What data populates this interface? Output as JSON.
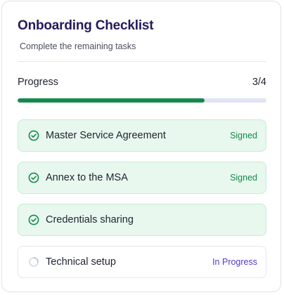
{
  "header": {
    "title": "Onboarding Checklist",
    "subtitle": "Complete the remaining tasks"
  },
  "progress": {
    "label": "Progress",
    "count_text": "3/4",
    "completed": 3,
    "total": 4,
    "fraction": 0.75
  },
  "colors": {
    "title": "#231a5c",
    "progress_fill": "#16894f",
    "progress_track": "#dfe4f5",
    "done_bg": "#e8f8ee",
    "done_border": "#c5ecd2",
    "signed": "#138a4d",
    "in_progress": "#4f3cc9"
  },
  "tasks": [
    {
      "label": "Master Service Agreement",
      "status": "Signed",
      "state": "done",
      "icon": "check-circle-icon"
    },
    {
      "label": "Annex to the MSA",
      "status": "Signed",
      "state": "done",
      "icon": "check-circle-icon"
    },
    {
      "label": "Credentials sharing",
      "status": "",
      "state": "done",
      "icon": "check-circle-icon"
    },
    {
      "label": "Technical setup",
      "status": "In Progress",
      "state": "pending",
      "icon": "loading-spinner-icon"
    }
  ]
}
